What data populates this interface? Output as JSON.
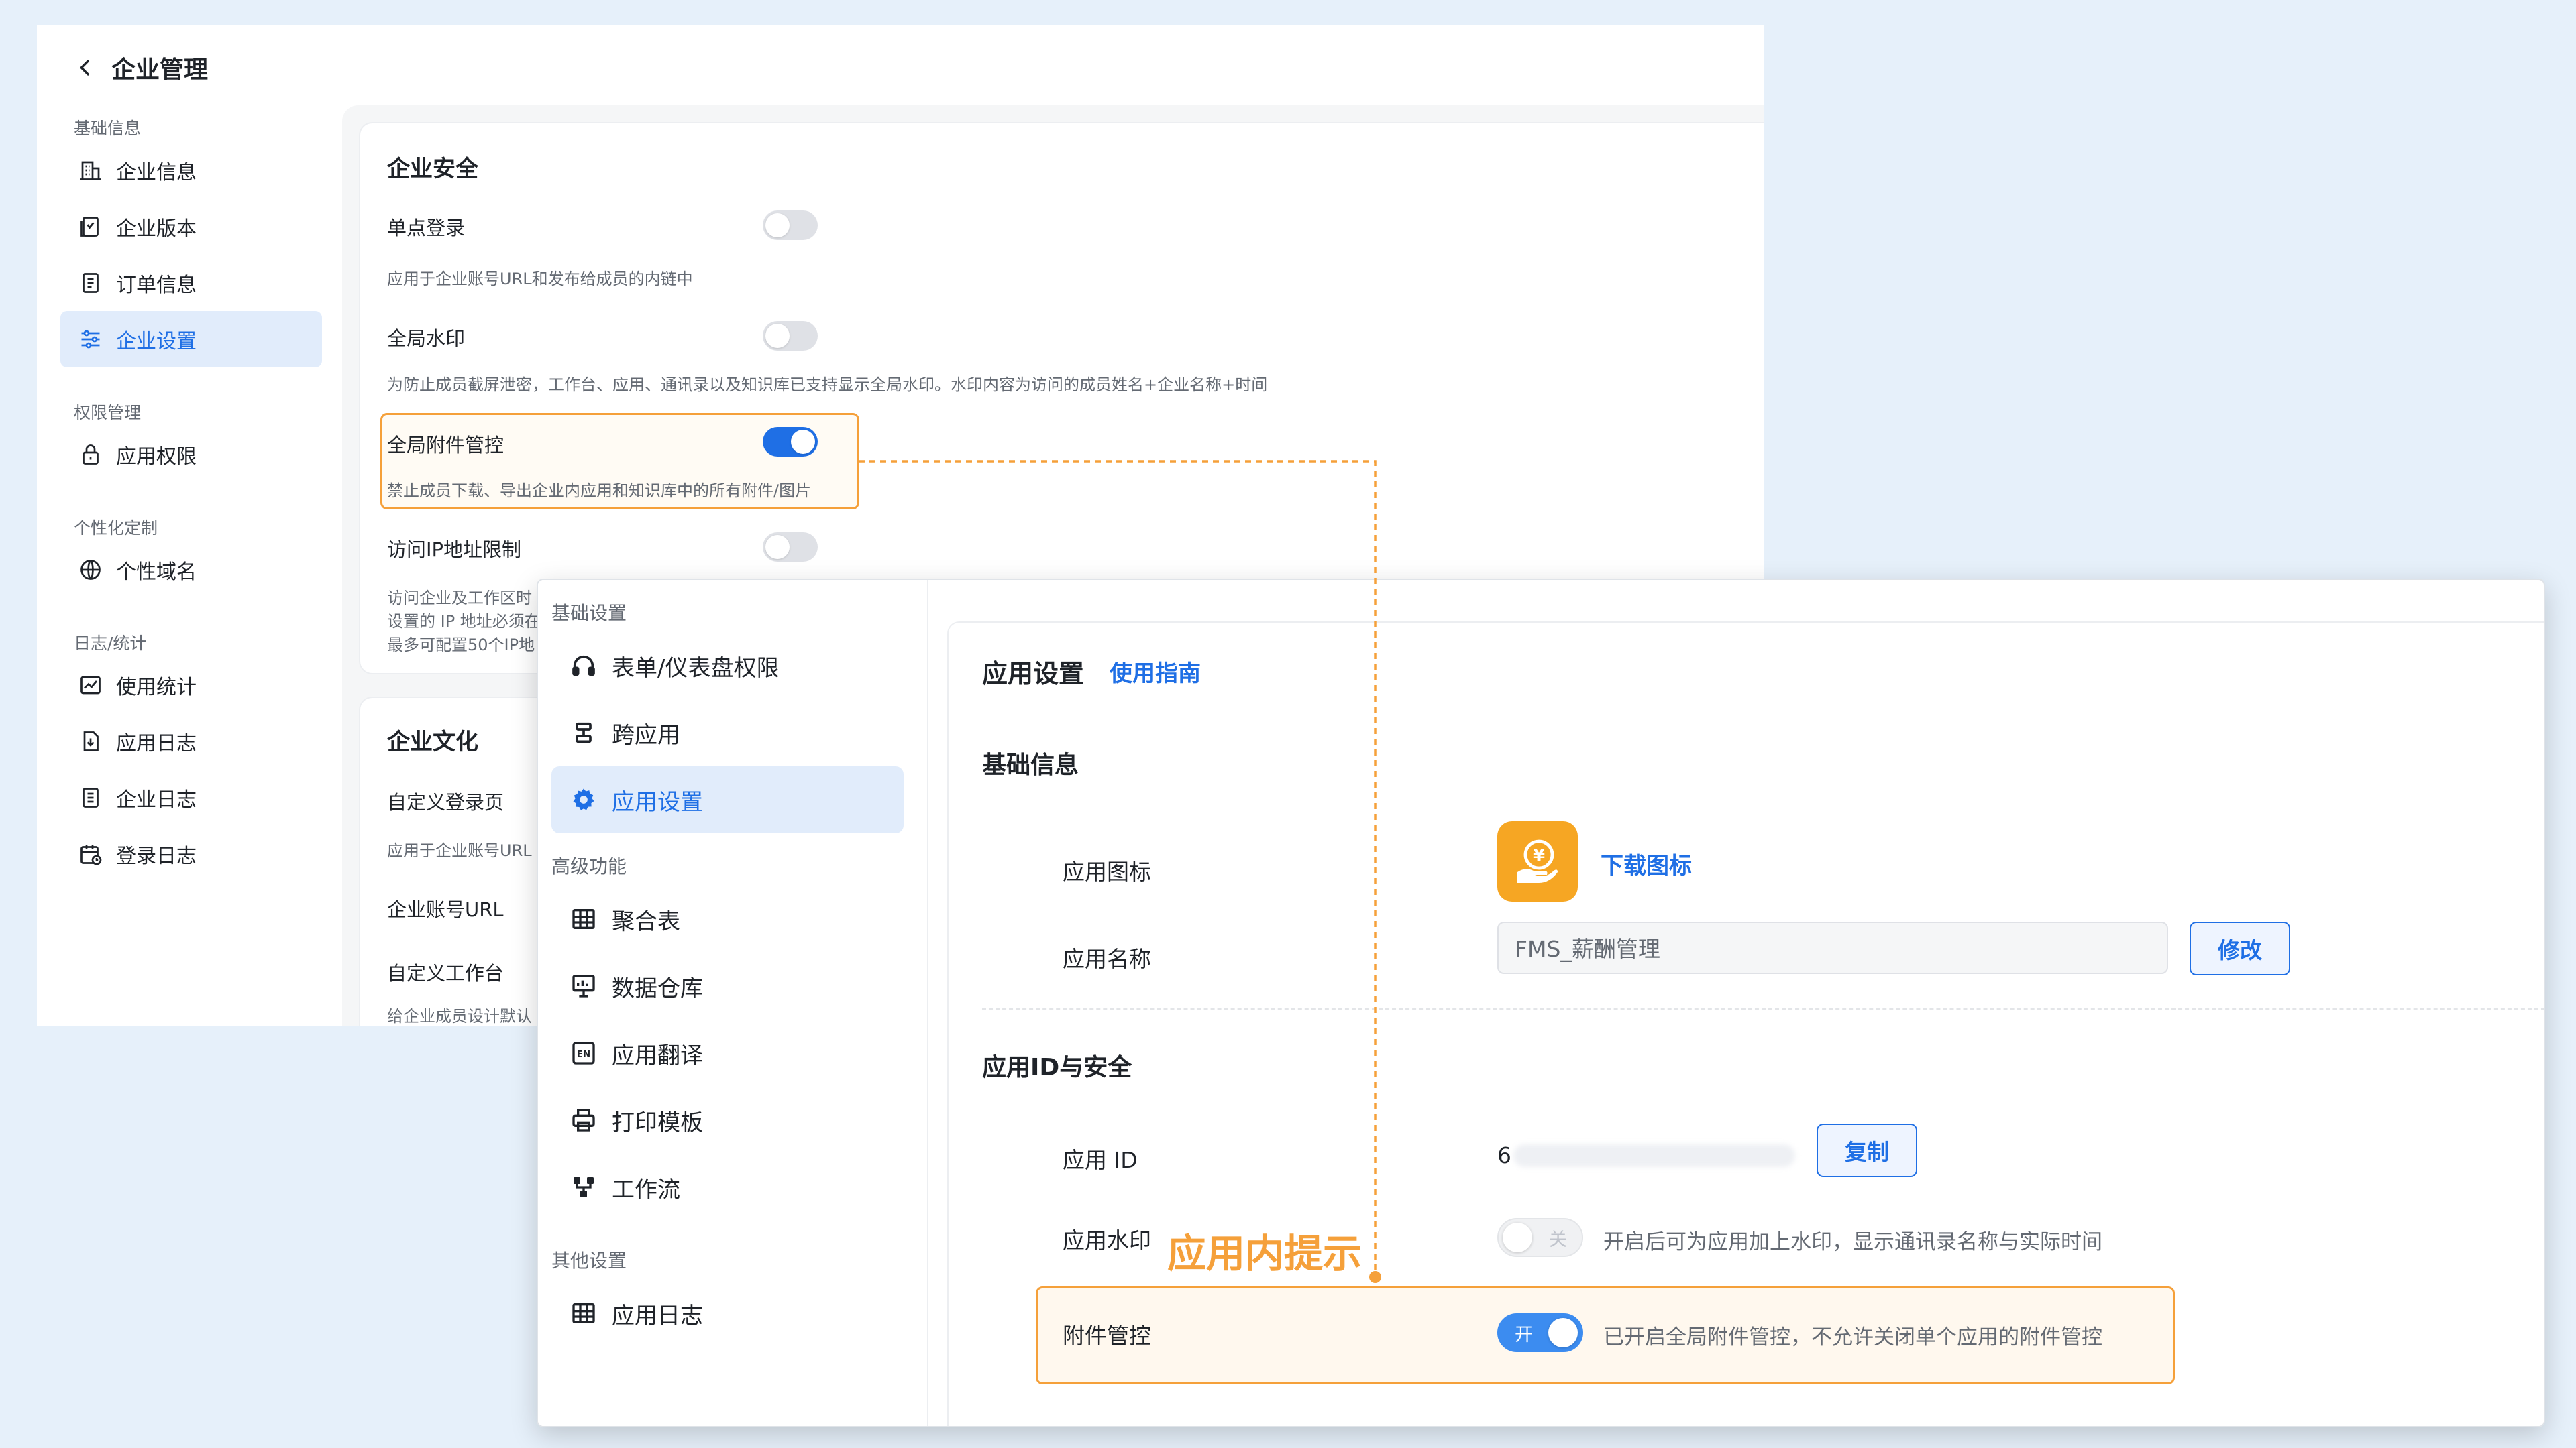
{
  "colors": {
    "accent": "#1f6fe5",
    "highlight": "#f5a03a",
    "app_icon_bg": "#f6a623"
  },
  "enterprise": {
    "header": {
      "title": "企业管理",
      "back_icon": "chevron-left-icon"
    },
    "nav": {
      "groups": [
        {
          "title": "基础信息",
          "items": [
            {
              "label": "企业信息",
              "icon": "building-icon"
            },
            {
              "label": "企业版本",
              "icon": "version-icon"
            },
            {
              "label": "订单信息",
              "icon": "order-icon"
            },
            {
              "label": "企业设置",
              "icon": "sliders-icon",
              "active": true
            }
          ]
        },
        {
          "title": "权限管理",
          "items": [
            {
              "label": "应用权限",
              "icon": "lock-icon"
            }
          ]
        },
        {
          "title": "个性化定制",
          "items": [
            {
              "label": "个性域名",
              "icon": "globe-icon"
            }
          ]
        },
        {
          "title": "日志/统计",
          "items": [
            {
              "label": "使用统计",
              "icon": "chart-icon"
            },
            {
              "label": "应用日志",
              "icon": "download-doc-icon"
            },
            {
              "label": "企业日志",
              "icon": "doc-icon"
            },
            {
              "label": "登录日志",
              "icon": "calendar-icon"
            }
          ]
        }
      ]
    },
    "security": {
      "title": "企业安全",
      "sso": {
        "label": "单点登录",
        "desc": "应用于企业账号URL和发布给成员的内链中",
        "enabled": false
      },
      "watermark": {
        "label": "全局水印",
        "desc": "为防止成员截屏泄密，工作台、应用、通讯录以及知识库已支持显示全局水印。水印内容为访问的成员姓名+企业名称+时间",
        "enabled": false
      },
      "attachment": {
        "label": "全局附件管控",
        "desc": "禁止成员下载、导出企业内应用和知识库中的所有附件/图片",
        "enabled": true
      },
      "ip_limit": {
        "label": "访问IP地址限制",
        "desc_lines": [
          "访问企业及工作区时",
          "设置的 IP 地址必须在",
          "最多可配置50个IP地"
        ],
        "enabled": false
      }
    },
    "culture": {
      "title": "企业文化",
      "custom_login": {
        "label": "自定义登录页",
        "desc": "应用于企业账号URL"
      },
      "account_url": {
        "label": "企业账号URL"
      },
      "custom_workbench": {
        "label": "自定义工作台",
        "desc": "给企业成员设计默认"
      }
    }
  },
  "app_settings": {
    "nav": {
      "groups": [
        {
          "title": "基础设置",
          "items": [
            {
              "label": "表单/仪表盘权限",
              "icon": "headphones-icon"
            },
            {
              "label": "跨应用",
              "icon": "link-icon"
            },
            {
              "label": "应用设置",
              "icon": "gear-icon",
              "active": true
            }
          ]
        },
        {
          "title": "高级功能",
          "items": [
            {
              "label": "聚合表",
              "icon": "table-icon"
            },
            {
              "label": "数据仓库",
              "icon": "monitor-icon"
            },
            {
              "label": "应用翻译",
              "icon": "translate-icon"
            },
            {
              "label": "打印模板",
              "icon": "printer-icon"
            },
            {
              "label": "工作流",
              "icon": "workflow-icon"
            }
          ]
        },
        {
          "title": "其他设置",
          "items": [
            {
              "label": "应用日志",
              "icon": "grid-icon"
            }
          ]
        }
      ]
    },
    "main": {
      "title": "应用设置",
      "guide_link": "使用指南",
      "basic": {
        "section": "基础信息",
        "icon_label": "应用图标",
        "download_icon": "下载图标",
        "name_label": "应用名称",
        "name_value": "FMS_薪酬管理",
        "modify_button": "修改"
      },
      "security": {
        "section": "应用ID与安全",
        "id_label": "应用 ID",
        "id_prefix": "6",
        "copy_button": "复制",
        "watermark_label": "应用水印",
        "watermark_state": "关",
        "watermark_desc": "开启后可为应用加上水印，显示通讯录名称与实际时间",
        "attachment_label": "附件管控",
        "attachment_state": "开",
        "attachment_desc": "已开启全局附件管控，不允许关闭单个应用的附件管控"
      }
    }
  },
  "annotation": {
    "text": "应用内提示"
  }
}
